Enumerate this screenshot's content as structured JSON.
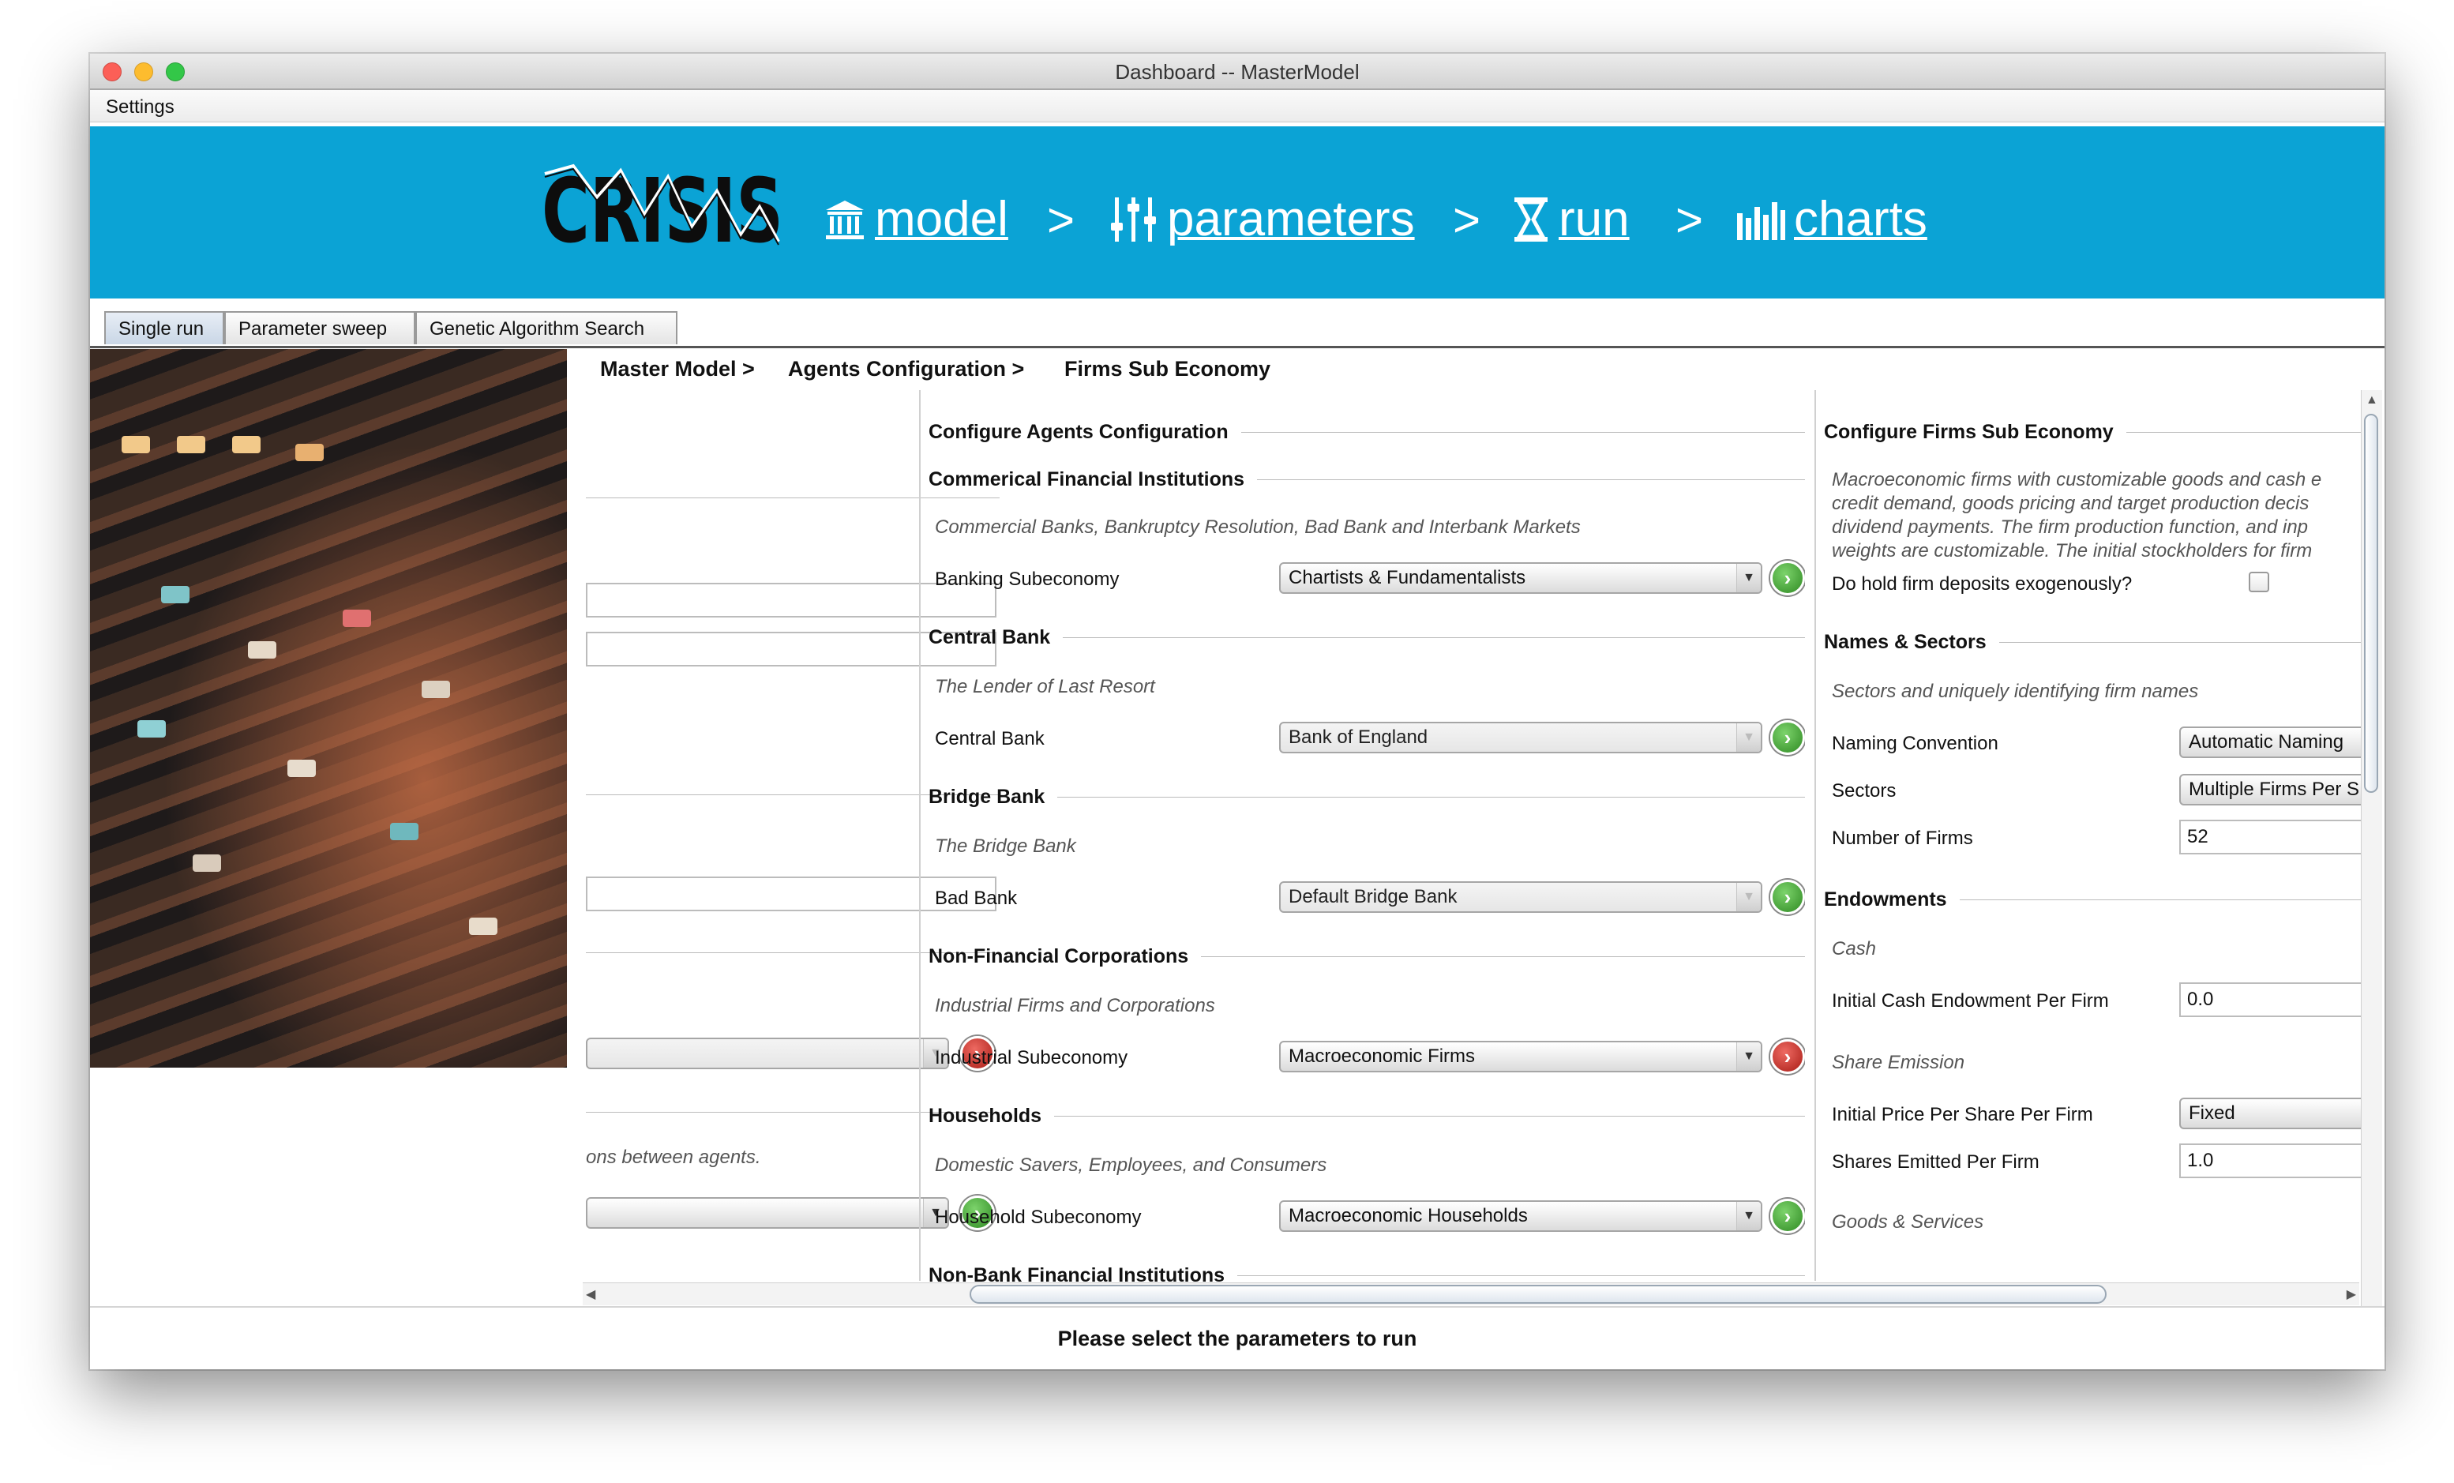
{
  "window": {
    "title": "Dashboard -- MasterModel"
  },
  "menubar": {
    "items": [
      "Settings"
    ]
  },
  "banner": {
    "logo_text": "CRISIS",
    "nav": [
      {
        "label": "model",
        "icon": "bank-icon"
      },
      {
        "label": "parameters",
        "icon": "sliders-icon"
      },
      {
        "label": "run",
        "icon": "hourglass-icon"
      },
      {
        "label": "charts",
        "icon": "bar-chart-icon"
      }
    ],
    "separator": ">"
  },
  "tabs": [
    {
      "label": "Single run",
      "active": true
    },
    {
      "label": "Parameter sweep",
      "active": false
    },
    {
      "label": "Genetic Algorithm Search",
      "active": false
    }
  ],
  "breadcrumb": [
    "Master Model >",
    "Agents Configuration >",
    "Firms Sub Economy"
  ],
  "left_column": {
    "truncated_desc": "ons between agents."
  },
  "middle_column": {
    "title": "Configure Agents Configuration",
    "sections": [
      {
        "heading": "Commerical Financial Institutions",
        "desc": "Commercial Banks, Bankruptcy Resolution, Bad Bank and Interbank Markets",
        "field_label": "Banking Subeconomy",
        "value": "Chartists & Fundamentalists",
        "enabled": true,
        "status": "green"
      },
      {
        "heading": "Central Bank",
        "desc": "The Lender of Last Resort",
        "field_label": "Central Bank",
        "value": "Bank of England",
        "enabled": false,
        "status": "green"
      },
      {
        "heading": "Bridge Bank",
        "desc": "The Bridge Bank",
        "field_label": "Bad Bank",
        "value": "Default Bridge Bank",
        "enabled": false,
        "status": "green"
      },
      {
        "heading": "Non-Financial Corporations",
        "desc": "Industrial Firms and Corporations",
        "field_label": "Industrial Subeconomy",
        "value": "Macroeconomic Firms",
        "enabled": true,
        "status": "red"
      },
      {
        "heading": "Households",
        "desc": "Domestic Savers, Employees, and Consumers",
        "field_label": "Household Subeconomy",
        "value": "Macroeconomic Households",
        "enabled": true,
        "status": "green"
      }
    ],
    "cut_heading": "Non-Bank Financial Institutions"
  },
  "right_column": {
    "title": "Configure Firms Sub Economy",
    "desc_lines": [
      "Macroeconomic firms with customizable goods and cash e",
      "credit demand, goods pricing and target production decis",
      "dividend payments. The firm production function, and inp",
      "weights are customizable. The initial stockholders for firm"
    ],
    "exogenous_label": "Do hold firm deposits exogenously?",
    "names_sectors": {
      "heading": "Names & Sectors",
      "desc": "Sectors and uniquely identifying firm names",
      "naming_label": "Naming Convention",
      "naming_value": "Automatic Naming",
      "sectors_label": "Sectors",
      "sectors_value": "Multiple Firms Per S",
      "num_label": "Number of Firms",
      "num_value": "52"
    },
    "endowments": {
      "heading": "Endowments",
      "cash_sub": "Cash",
      "cash_label": "Initial Cash Endowment Per Firm",
      "cash_value": "0.0",
      "share_sub": "Share Emission",
      "price_label": "Initial Price Per Share Per Firm",
      "price_value": "Fixed",
      "shares_label": "Shares Emitted Per Firm",
      "shares_value": "1.0",
      "goods_sub": "Goods & Services"
    }
  },
  "status_bar": {
    "text": "Please select the parameters to run"
  }
}
